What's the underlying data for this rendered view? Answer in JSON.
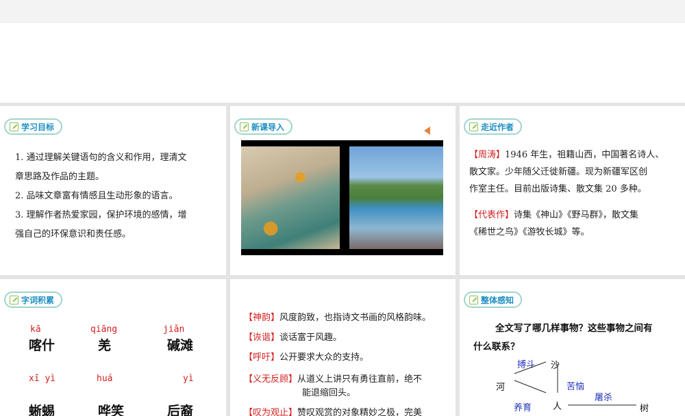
{
  "slides": [
    {
      "title": "学习目标",
      "lines": [
        "1. 通过理解关键语句的含义和作用，理清文",
        "章思路及作品的主题。",
        "2. 品味文章富有情感且生动形象的语言。",
        "3. 理解作者热爱家园，保护环境的感情，增",
        "强自己的环保意识和责任感。"
      ]
    },
    {
      "title": "新课导入",
      "audio_icon": "speaker-icon"
    },
    {
      "title": "走近作者",
      "author_tag": "【周涛】",
      "author_lines": [
        "1946 年生，祖籍山西，中国著名诗人、",
        "散文家。少年随父迁徙新疆。现为新疆军区创",
        "作室主任。目前出版诗集、散文集 20 多种。"
      ],
      "works_tag": "【代表作】",
      "works_lines": [
        "诗集《神山》《野马群》，散文集",
        "《稀世之鸟》《游牧长城》等。"
      ]
    },
    {
      "title": "字词积累",
      "words": [
        {
          "py": "kā",
          "hz": "喀什"
        },
        {
          "py": "qiāng",
          "hz": "羌"
        },
        {
          "py": "jiǎn",
          "hz": "碱滩"
        },
        {
          "py": "xī yì",
          "hz": "蜥蜴"
        },
        {
          "py": "huá",
          "hz": "哗笑"
        },
        {
          "py": "yì",
          "hz": "后裔"
        }
      ]
    },
    {
      "defs": [
        {
          "term": "【神韵】",
          "text": "风度韵致，也指诗文书画的风格韵味。"
        },
        {
          "term": "【诙谐】",
          "text": "谈话富于风趣。"
        },
        {
          "term": "【呼吁】",
          "text": "公开要求大众的支持。"
        },
        {
          "term": "【义无反顾】",
          "text": "从道义上讲只有勇往直前，绝不",
          "text2": "能退缩回头。"
        },
        {
          "term": "【叹为观止】",
          "text": "赞叹观赏的对象精妙之极，完美"
        }
      ]
    },
    {
      "title": "整体感知",
      "question1": "全文写了哪几样事物？这些事物之间有",
      "question2": "什么联系？",
      "nodes": {
        "river": "河",
        "sand": "沙",
        "people": "人",
        "tree": "树"
      },
      "relations": {
        "fight": "搏斗",
        "trouble": "苦恼",
        "slaughter": "屠杀",
        "nurture": "养育"
      }
    }
  ]
}
